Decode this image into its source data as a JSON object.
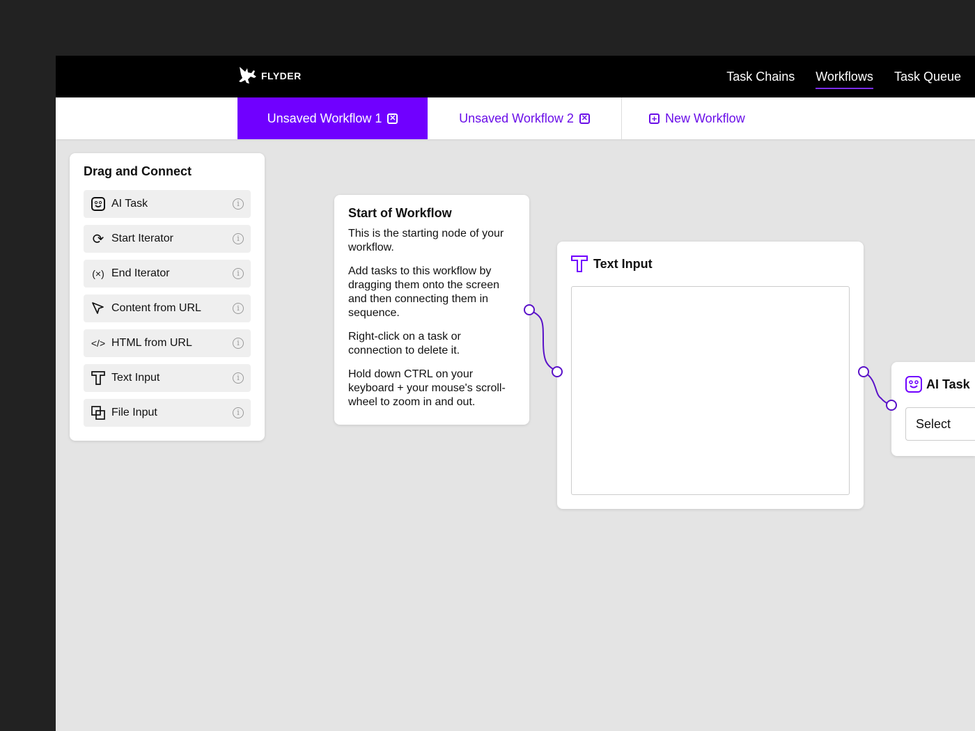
{
  "brand": "FLYDER",
  "nav": [
    "Task Chains",
    "Workflows",
    "Task Queue"
  ],
  "tabs": {
    "tab1": "Unsaved Workflow 1",
    "tab2": "Unsaved Workflow 2",
    "new": "New Workflow"
  },
  "panel": {
    "title": "Drag and Connect",
    "items": [
      "AI Task",
      "Start Iterator",
      "End Iterator",
      "Content from URL",
      "HTML from URL",
      "Text Input",
      "File Input"
    ]
  },
  "start": {
    "title": "Start of Workflow",
    "p1": "This is the starting node of your workflow.",
    "p2": "Add tasks to this workflow by dragging them onto the screen and then connecting them in sequence.",
    "p3": "Right-click on a task or connection to delete it.",
    "p4": "Hold down CTRL on your keyboard + your mouse's scroll-wheel to zoom in and out."
  },
  "text_input": {
    "title": "Text Input",
    "value": ""
  },
  "ai_task": {
    "title": "AI Task",
    "select": "Select"
  },
  "colors": {
    "accent": "#7000ff",
    "wire": "#5a12c8"
  }
}
